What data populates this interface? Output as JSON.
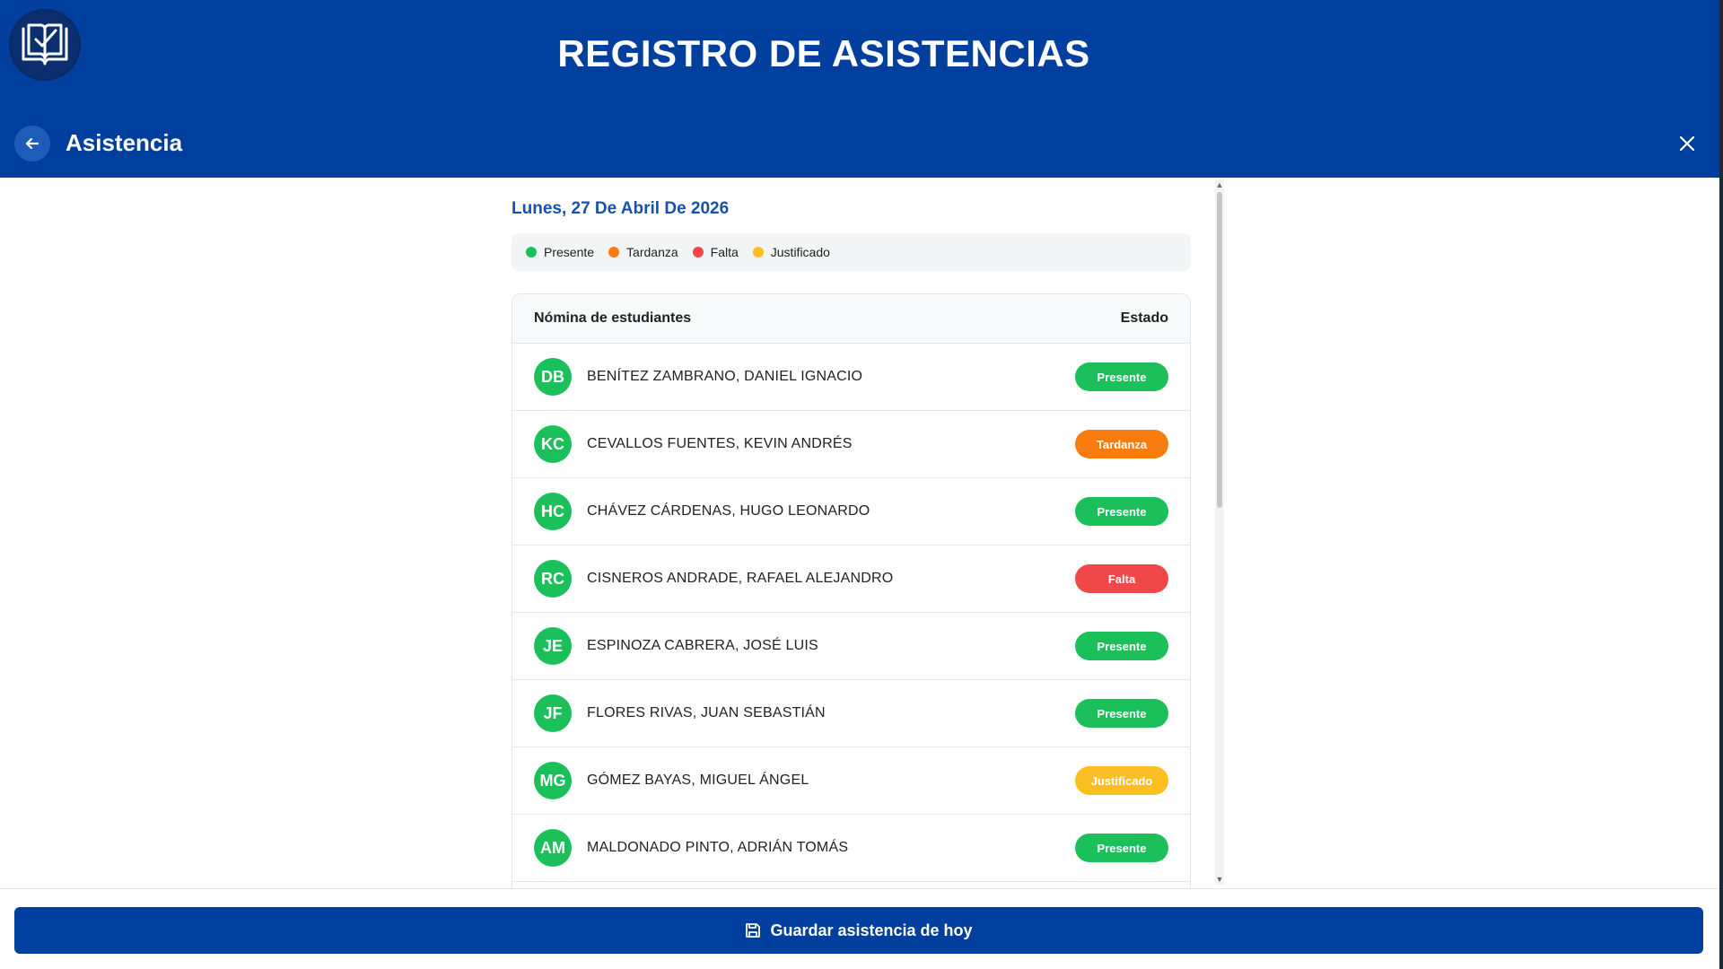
{
  "header": {
    "app_title": "REGISTRO DE ASISTENCIAS",
    "section_title": "Asistencia",
    "logo_icon": "book-check-icon",
    "back_icon": "arrow-left-icon",
    "close_icon": "close-icon"
  },
  "date_label": "Lunes, 27 De Abril De 2026",
  "legend": [
    {
      "label": "Presente",
      "color": "#1cc05a"
    },
    {
      "label": "Tardanza",
      "color": "#f97c10"
    },
    {
      "label": "Falta",
      "color": "#f04848"
    },
    {
      "label": "Justificado",
      "color": "#fbbf24"
    }
  ],
  "table": {
    "col_students": "Nómina de estudiantes",
    "col_status": "Estado",
    "rows": [
      {
        "initials": "DB",
        "name": "BENÍTEZ ZAMBRANO, DANIEL IGNACIO",
        "status": "Presente",
        "color": "#1cc05a"
      },
      {
        "initials": "KC",
        "name": "CEVALLOS FUENTES, KEVIN ANDRÉS",
        "status": "Tardanza",
        "color": "#f97c10"
      },
      {
        "initials": "HC",
        "name": "CHÁVEZ CÁRDENAS, HUGO LEONARDO",
        "status": "Presente",
        "color": "#1cc05a"
      },
      {
        "initials": "RC",
        "name": "CISNEROS ANDRADE, RAFAEL ALEJANDRO",
        "status": "Falta",
        "color": "#f04848"
      },
      {
        "initials": "JE",
        "name": "ESPINOZA CABRERA, JOSÉ LUIS",
        "status": "Presente",
        "color": "#1cc05a"
      },
      {
        "initials": "JF",
        "name": "FLORES RIVAS, JUAN SEBASTIÁN",
        "status": "Presente",
        "color": "#1cc05a"
      },
      {
        "initials": "MG",
        "name": "GÓMEZ BAYAS, MIGUEL ÁNGEL",
        "status": "Justificado",
        "color": "#fbbf24"
      },
      {
        "initials": "AM",
        "name": "MALDONADO PINTO, ADRIÁN TOMÁS",
        "status": "Presente",
        "color": "#1cc05a"
      }
    ]
  },
  "footer": {
    "save_label": "Guardar asistencia de hoy",
    "save_icon": "save-icon"
  },
  "colors": {
    "primary": "#003f9e",
    "accent_text": "#1553a8"
  }
}
